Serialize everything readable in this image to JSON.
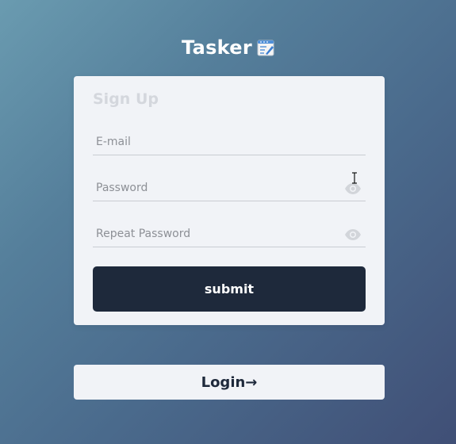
{
  "app": {
    "title": "Tasker",
    "title_icon": "notepad-icon"
  },
  "form": {
    "heading": "Sign Up",
    "email": {
      "placeholder": "E-mail",
      "value": ""
    },
    "password": {
      "placeholder": "Password",
      "value": "",
      "toggle_icon": "eye-icon"
    },
    "repeat_password": {
      "placeholder": "Repeat Password",
      "value": "",
      "toggle_icon": "eye-icon"
    },
    "submit_label": "submit"
  },
  "footer": {
    "login_label": "Login→"
  },
  "colors": {
    "card_background": "#f1f3f7",
    "button_dark": "#1e293b",
    "heading_muted": "#d4d7dd",
    "placeholder": "#8d9096"
  }
}
